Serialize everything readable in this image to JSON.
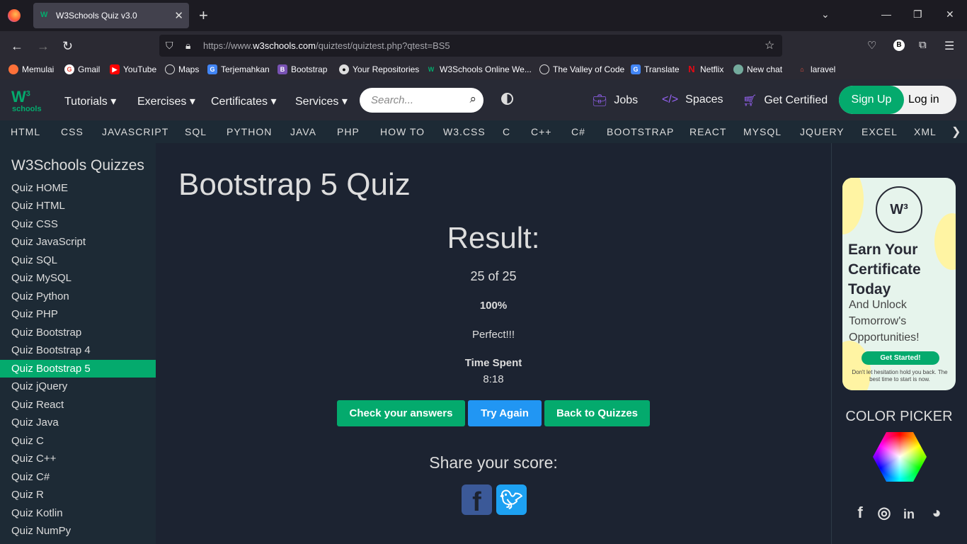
{
  "browser": {
    "tab_title": "W3Schools Quiz v3.0",
    "url_prefix": "https://www.",
    "url_domain": "w3schools.com",
    "url_path": "/quiztest/quiztest.php?qtest=BS5",
    "bookmarks": [
      "Memulai",
      "Gmail",
      "YouTube",
      "Maps",
      "Terjemahkan",
      "Bootstrap",
      "Your Repositories",
      "W3Schools Online We...",
      "The Valley of Code",
      "Translate",
      "Netflix",
      "New chat",
      "laravel"
    ]
  },
  "site": {
    "logo_text": "schools",
    "logo_sup": "3",
    "menu": [
      "Tutorials",
      "Exercises",
      "Certificates",
      "Services"
    ],
    "search_placeholder": "Search...",
    "jobs": "Jobs",
    "spaces": "Spaces",
    "get_certified": "Get Certified",
    "signup": "Sign Up",
    "login": "Log in",
    "topics": [
      "HTML",
      "CSS",
      "JAVASCRIPT",
      "SQL",
      "PYTHON",
      "JAVA",
      "PHP",
      "HOW TO",
      "W3.CSS",
      "C",
      "C++",
      "C#",
      "BOOTSTRAP",
      "REACT",
      "MYSQL",
      "JQUERY",
      "EXCEL",
      "XML"
    ]
  },
  "sidebar": {
    "title": "W3Schools Quizzes",
    "items": [
      "Quiz HOME",
      "Quiz HTML",
      "Quiz CSS",
      "Quiz JavaScript",
      "Quiz SQL",
      "Quiz MySQL",
      "Quiz Python",
      "Quiz PHP",
      "Quiz Bootstrap",
      "Quiz Bootstrap 4",
      "Quiz Bootstrap 5",
      "Quiz jQuery",
      "Quiz React",
      "Quiz Java",
      "Quiz C",
      "Quiz C++",
      "Quiz C#",
      "Quiz R",
      "Quiz Kotlin",
      "Quiz NumPy"
    ],
    "active": "Quiz Bootstrap 5"
  },
  "result": {
    "page_title": "Bootstrap 5 Quiz",
    "heading": "Result:",
    "score": "25 of 25",
    "percent": "100%",
    "message": "Perfect!!!",
    "time_label": "Time Spent",
    "time_value": "8:18",
    "btn_check": "Check your answers",
    "btn_retry": "Try Again",
    "btn_back": "Back to Quizzes",
    "share_label": "Share your score:"
  },
  "ad": {
    "headline_1": "Earn Your",
    "headline_2": "Certificate",
    "headline_3": "Today",
    "sub_1": "And Unlock",
    "sub_2": "Tomorrow's",
    "sub_3": "Opportunities!",
    "cta": "Get Started!",
    "fine_print": "Don't let hesitation hold you back. The best time to start is now."
  },
  "color_picker_title": "COLOR PICKER",
  "colors": {
    "accent": "#04aa6d",
    "blue_button": "#2196f3",
    "facebook": "#3b5998",
    "twitter": "#1da1f2"
  }
}
